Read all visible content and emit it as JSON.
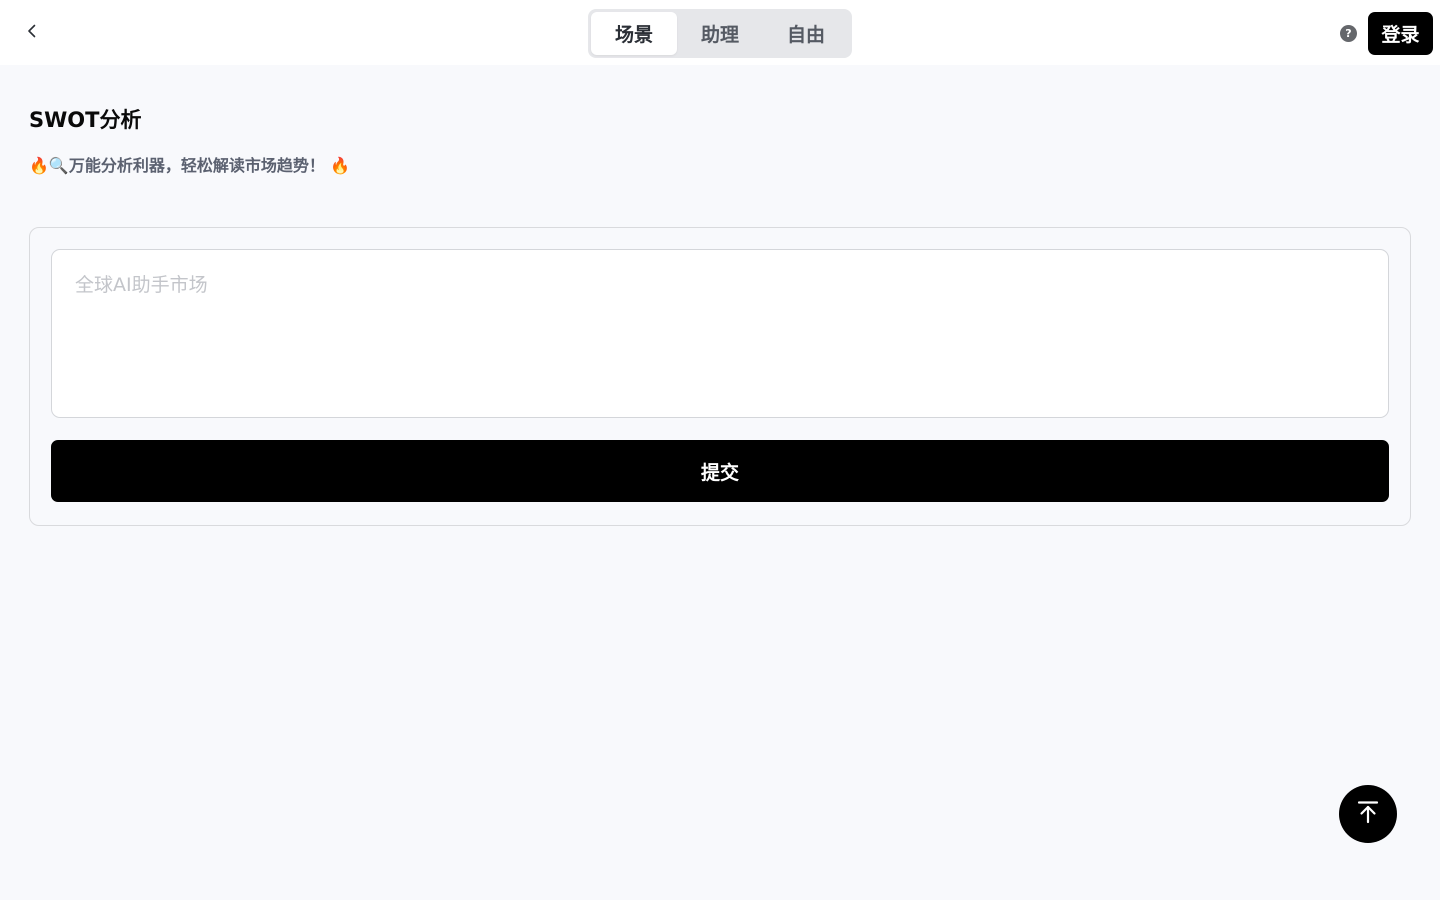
{
  "header": {
    "back_icon": "chevron-left-icon",
    "tabs": [
      {
        "label": "场景",
        "active": true
      },
      {
        "label": "助理",
        "active": false
      },
      {
        "label": "自由",
        "active": false
      }
    ],
    "help_icon": "question-circle-icon",
    "help_glyph": "?",
    "login_label": "登录"
  },
  "main": {
    "title": "SWOT分析",
    "subtitle": "🔥🔍万能分析利器，轻松解读市场趋势！ 🔥",
    "input": {
      "placeholder": "全球AI助手市场",
      "value": ""
    },
    "submit_label": "提交"
  },
  "floating": {
    "scroll_top_icon": "arrow-up-to-top-icon"
  },
  "colors": {
    "page_background": "#f8f9fc",
    "primary_button": "#000000",
    "tab_bar_background": "#e6e7ea",
    "subtitle_text": "#5b6170",
    "placeholder_text": "#c3c5ca"
  }
}
